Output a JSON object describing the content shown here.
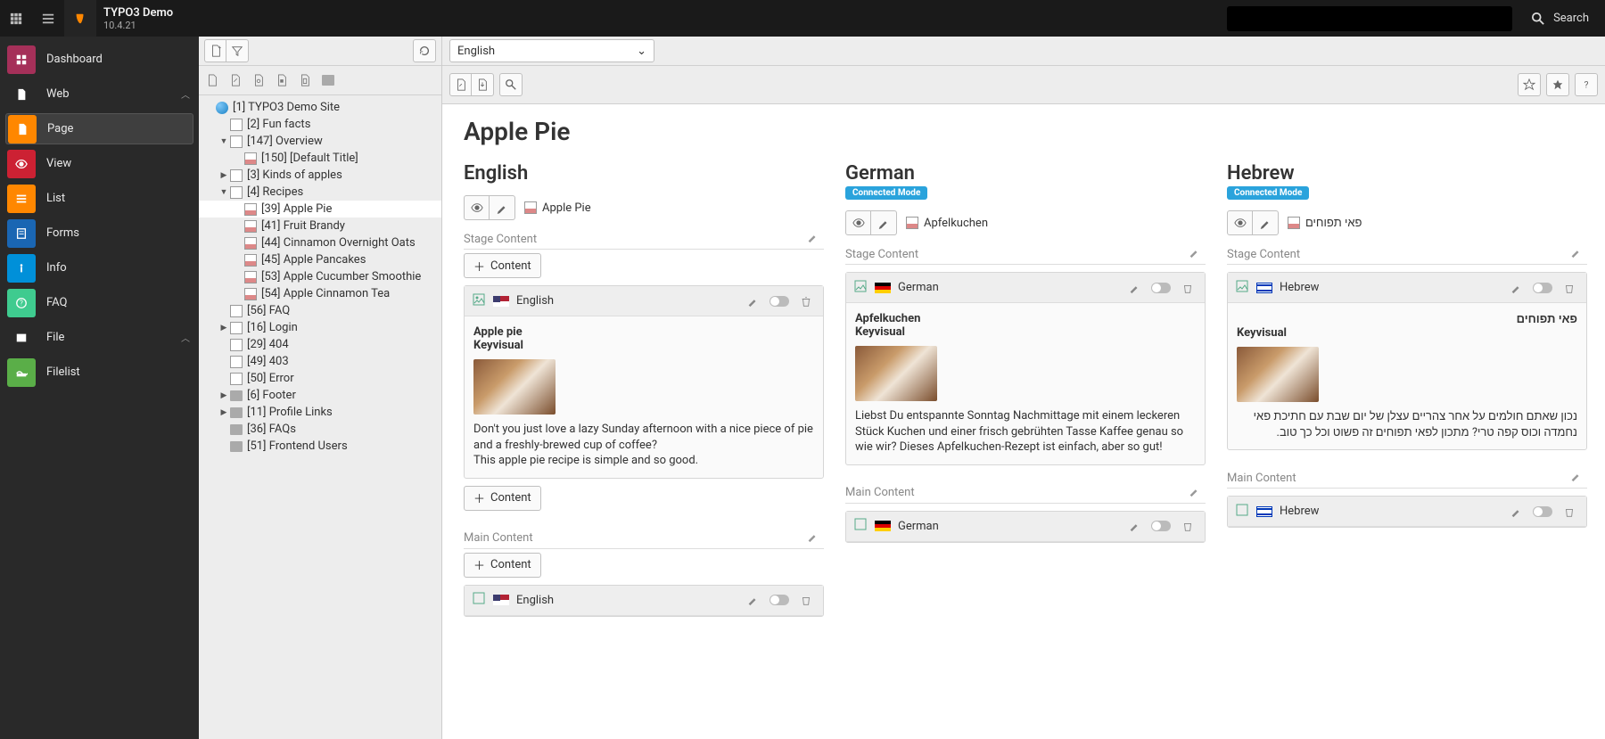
{
  "topbar": {
    "app_title": "TYPO3 Demo",
    "version": "10.4.21",
    "search_label": "Search"
  },
  "modules": {
    "dashboard": "Dashboard",
    "web_group": "Web",
    "page": "Page",
    "view": "View",
    "list": "List",
    "forms": "Forms",
    "info": "Info",
    "faq": "FAQ",
    "file_group": "File",
    "filelist": "Filelist"
  },
  "tree": [
    {
      "depth": 0,
      "toggle": "",
      "icon": "globe",
      "label": "[1] TYPO3 Demo Site"
    },
    {
      "depth": 1,
      "toggle": "",
      "icon": "page",
      "label": "[2] Fun facts"
    },
    {
      "depth": 1,
      "toggle": "▼",
      "icon": "page",
      "label": "[147] Overview"
    },
    {
      "depth": 2,
      "toggle": "",
      "icon": "page-image",
      "label": "[150] [Default Title]"
    },
    {
      "depth": 1,
      "toggle": "▶",
      "icon": "page",
      "label": "[3] Kinds of apples"
    },
    {
      "depth": 1,
      "toggle": "▼",
      "icon": "page",
      "label": "[4] Recipes"
    },
    {
      "depth": 2,
      "toggle": "",
      "icon": "page-image",
      "label": "[39] Apple Pie",
      "selected": true
    },
    {
      "depth": 2,
      "toggle": "",
      "icon": "page-image",
      "label": "[41] Fruit Brandy"
    },
    {
      "depth": 2,
      "toggle": "",
      "icon": "page-image",
      "label": "[44] Cinnamon Overnight Oats"
    },
    {
      "depth": 2,
      "toggle": "",
      "icon": "page-image",
      "label": "[45] Apple Pancakes"
    },
    {
      "depth": 2,
      "toggle": "",
      "icon": "page-image",
      "label": "[53] Apple Cucumber Smoothie"
    },
    {
      "depth": 2,
      "toggle": "",
      "icon": "page-image",
      "label": "[54] Apple Cinnamon Tea"
    },
    {
      "depth": 1,
      "toggle": "",
      "icon": "page",
      "label": "[56] FAQ"
    },
    {
      "depth": 1,
      "toggle": "▶",
      "icon": "page",
      "label": "[16] Login"
    },
    {
      "depth": 1,
      "toggle": "",
      "icon": "page",
      "label": "[29] 404"
    },
    {
      "depth": 1,
      "toggle": "",
      "icon": "page",
      "label": "[49] 403"
    },
    {
      "depth": 1,
      "toggle": "",
      "icon": "page",
      "label": "[50] Error"
    },
    {
      "depth": 1,
      "toggle": "▶",
      "icon": "folder",
      "label": "[6] Footer"
    },
    {
      "depth": 1,
      "toggle": "▶",
      "icon": "folder",
      "label": "[11] Profile Links"
    },
    {
      "depth": 1,
      "toggle": "",
      "icon": "folder",
      "label": "[36] FAQs"
    },
    {
      "depth": 1,
      "toggle": "",
      "icon": "folder",
      "label": "[51] Frontend Users"
    }
  ],
  "toolbar": {
    "language_selector": "English"
  },
  "page": {
    "title": "Apple Pie",
    "section_stage": "Stage Content",
    "section_main": "Main Content",
    "add_content": "Content",
    "conn_badge": "Connected Mode"
  },
  "languages": {
    "english": {
      "header": "English",
      "page_label": "Apple Pie",
      "ce_lang": "English",
      "ce_title1": "Apple pie",
      "ce_title2": "Keyvisual",
      "ce_text": "Don't you just love a lazy Sunday afternoon with a nice piece of pie and a freshly-brewed cup of coffee?\nThis apple pie recipe is simple and so good."
    },
    "german": {
      "header": "German",
      "page_label": "Apfelkuchen",
      "ce_lang": "German",
      "ce_title1": "Apfelkuchen",
      "ce_title2": "Keyvisual",
      "ce_text": "Liebst Du entspannte Sonntag Nachmittage mit einem leckeren Stück Kuchen und einer frisch gebrühten Tasse Kaffee genau so wie wir? Dieses Apfelkuchen-Rezept ist einfach, aber so gut!"
    },
    "hebrew": {
      "header": "Hebrew",
      "page_label": "פאי תפוחים",
      "ce_lang": "Hebrew",
      "ce_title1": "פאי תפוחים",
      "ce_title2": "Keyvisual",
      "ce_text": "נכון שאתם חולמים על אחר צהריים עצלן של יום שבת עם חתיכת פאי נחמדה וכוס קפה טרי? מתכון לפאי תפוחים זה פשוט וכל כך טוב."
    }
  }
}
